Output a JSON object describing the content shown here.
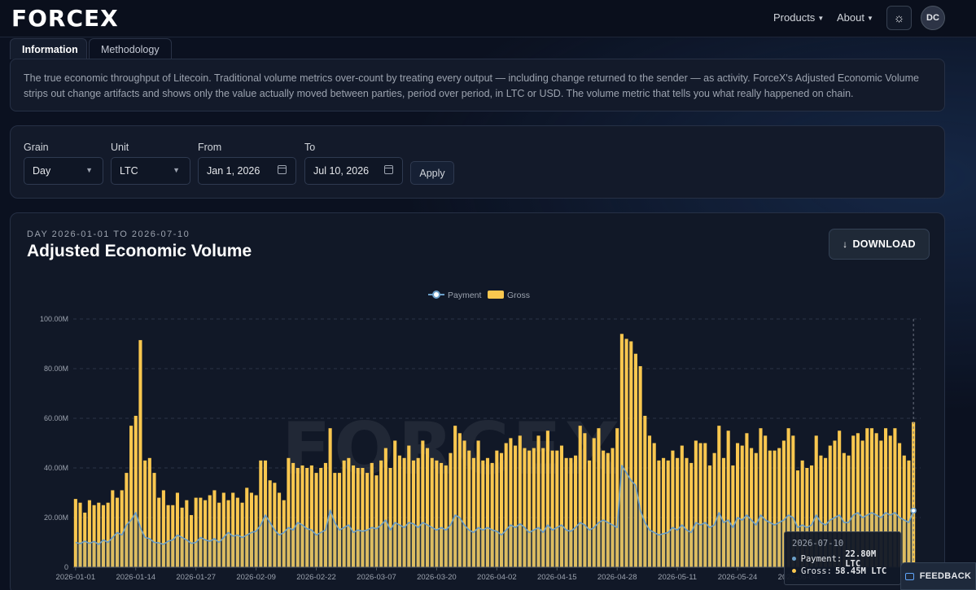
{
  "header": {
    "logo": "FORCEX",
    "nav": [
      {
        "label": "Products"
      },
      {
        "label": "About"
      }
    ],
    "avatar_initials": "DC"
  },
  "tabs": [
    {
      "label": "Information",
      "active": true
    },
    {
      "label": "Methodology",
      "active": false
    }
  ],
  "info": {
    "text": "The true economic throughput of Litecoin. Traditional volume metrics over-count by treating every output — including change returned to the sender — as activity. ForceX's Adjusted Economic Volume strips out change artifacts and shows only the value actually moved between parties, period over period, in LTC or USD. The volume metric that tells you what really happened on chain."
  },
  "filters": {
    "grain": {
      "label": "Grain",
      "value": "Day"
    },
    "unit": {
      "label": "Unit",
      "value": "LTC"
    },
    "from": {
      "label": "From",
      "value": "Jan 1, 2026"
    },
    "to": {
      "label": "To",
      "value": "Jul 10, 2026"
    },
    "apply_label": "Apply"
  },
  "chart_header": {
    "subtitle": "DAY 2026-01-01 TO 2026-07-10",
    "title": "Adjusted Economic Volume",
    "download_label": "DOWNLOAD"
  },
  "watermark": "FORCEX",
  "tooltip": {
    "date": "2026-07-10",
    "payment_label": "Payment",
    "payment_value": "22.80M LTC",
    "gross_label": "Gross",
    "gross_value": "58.45M LTC"
  },
  "feedback_label": "FEEDBACK",
  "colors": {
    "gross": "#f9c74f",
    "payment": "#6b9fc8",
    "background": "#0b1120"
  },
  "chart_data": {
    "type": "bar",
    "legend": {
      "placement": "top-center",
      "entries": [
        "Payment",
        "Gross"
      ]
    },
    "grid": true,
    "ylim": [
      0,
      100000000
    ],
    "yticks": [
      {
        "value": 0,
        "label": "0"
      },
      {
        "value": 20000000,
        "label": "20.00M"
      },
      {
        "value": 40000000,
        "label": "40.00M"
      },
      {
        "value": 60000000,
        "label": "60.00M"
      },
      {
        "value": 80000000,
        "label": "80.00M"
      },
      {
        "value": 100000000,
        "label": "100.00M"
      }
    ],
    "xticks": [
      "2026-01-01",
      "2026-01-14",
      "2026-01-27",
      "2026-02-09",
      "2026-02-22",
      "2026-03-07",
      "2026-03-20",
      "2026-04-02",
      "2026-04-15",
      "2026-04-28",
      "2026-05-11",
      "2026-05-24",
      "2026-06-06"
    ],
    "start_date": "2026-01-01",
    "unit": "LTC",
    "series": [
      {
        "name": "Gross",
        "type": "bar",
        "values": [
          27.5,
          26,
          22,
          27,
          25,
          26,
          25,
          26,
          31,
          28,
          31,
          38,
          57,
          61,
          91.5,
          43,
          44,
          38,
          28,
          31,
          25,
          25,
          30,
          24,
          27,
          21,
          28,
          28,
          27,
          29,
          31,
          26,
          30,
          27,
          30,
          28,
          26,
          32,
          30,
          29,
          43,
          43,
          35,
          34,
          30,
          27,
          44,
          42,
          40,
          41,
          40,
          41,
          38,
          40,
          42,
          56,
          38,
          38,
          43,
          44,
          41,
          40,
          40,
          38,
          42,
          37,
          43,
          48,
          40,
          51,
          45,
          44,
          49,
          43,
          44,
          51,
          48,
          44,
          43,
          42,
          41,
          46,
          57,
          54,
          51,
          47,
          44,
          51,
          43,
          44,
          42,
          47,
          46,
          50,
          52,
          49,
          53,
          48,
          47,
          48,
          53,
          48,
          55,
          47,
          47,
          49,
          44,
          44,
          45,
          57,
          54,
          43,
          52,
          56,
          47,
          46,
          48,
          56,
          94,
          92,
          91,
          86,
          81,
          61,
          53,
          50,
          43,
          44,
          43,
          47,
          44,
          49,
          44,
          42,
          51,
          50,
          50,
          41,
          46,
          57,
          44,
          55,
          41,
          50,
          49,
          54,
          48,
          46,
          56,
          53,
          47,
          47,
          48,
          51,
          56,
          53,
          39,
          43,
          40,
          41,
          53,
          45,
          44,
          49,
          51,
          55,
          46,
          45,
          53,
          54,
          51,
          56,
          56,
          54,
          51,
          56,
          53,
          56,
          50,
          45,
          43,
          58.45
        ]
      },
      {
        "name": "Payment",
        "type": "line",
        "values": [
          10,
          9.5,
          10.5,
          9.6,
          10.4,
          9.2,
          11,
          10,
          12,
          14,
          13,
          17,
          19,
          22,
          16,
          12,
          11.5,
          10,
          9.8,
          9.2,
          10.5,
          11,
          13,
          12,
          11,
          9.6,
          10,
          12,
          11,
          10.5,
          11.5,
          10,
          12,
          14,
          12.5,
          13,
          12,
          13,
          14,
          14.5,
          17,
          21,
          18,
          15,
          13,
          14,
          16,
          15,
          18,
          17,
          15.5,
          15,
          13,
          14,
          15,
          23,
          18,
          15,
          16,
          17,
          14,
          15,
          14.5,
          15,
          16,
          15.5,
          17,
          19,
          15,
          18,
          17,
          16,
          18,
          17.5,
          16,
          18,
          17,
          16,
          15,
          16,
          15,
          17,
          21,
          20,
          17,
          15,
          14,
          16,
          15,
          16,
          15,
          14.5,
          13,
          15,
          17,
          16,
          17.5,
          16,
          14,
          15,
          16,
          14,
          17,
          15,
          16,
          17,
          15,
          14.5,
          16,
          18,
          17,
          15,
          16,
          18,
          19,
          18,
          17,
          16,
          41,
          38,
          35,
          33,
          23,
          18,
          15,
          14,
          13,
          13.5,
          14,
          16,
          15,
          17,
          15,
          14,
          18,
          17,
          18,
          16,
          17,
          22,
          18,
          19,
          16,
          20,
          19,
          21,
          19,
          17,
          21,
          19,
          18,
          17,
          18,
          19,
          21,
          20,
          16,
          17,
          16,
          17,
          21,
          18,
          17,
          19,
          20,
          21,
          18,
          18,
          21,
          22,
          20,
          21,
          22,
          21,
          20,
          22,
          21,
          22,
          20,
          19,
          18,
          22.8
        ]
      }
    ]
  }
}
